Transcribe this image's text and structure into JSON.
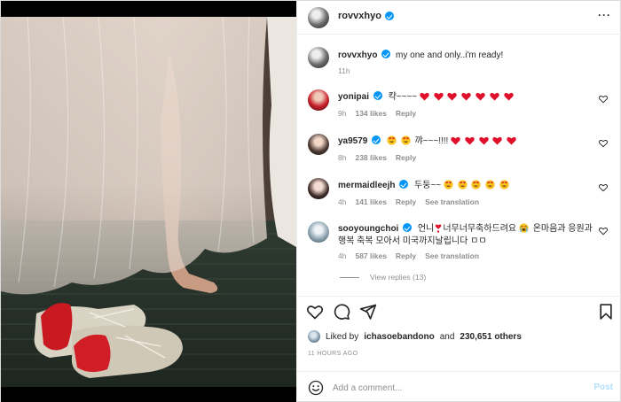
{
  "post": {
    "username": "rovvxhyo",
    "more_label": "···",
    "caption": "my one and only..i'm ready!",
    "caption_time": "11h"
  },
  "comments": [
    {
      "username": "yonipai",
      "text": "캭~~~~",
      "emoji_after": [
        "heart",
        "heart",
        "heart",
        "heart",
        "heart",
        "heart",
        "heart"
      ],
      "time": "9h",
      "likes": "134 likes",
      "reply": "Reply",
      "translation": ""
    },
    {
      "username": "ya9579",
      "text": "꺄~~~!!!!",
      "emoji_before": [
        "heart-eyes-face",
        "heart-eyes-face"
      ],
      "emoji_after": [
        "heart",
        "heart",
        "heart",
        "heart",
        "heart"
      ],
      "time": "8h",
      "likes": "238 likes",
      "reply": "Reply",
      "translation": ""
    },
    {
      "username": "mermaidleejh",
      "text": "두둥~~",
      "emoji_after": [
        "heart-eyes-face",
        "heart-eyes-face",
        "heart-eyes-face",
        "heart-eyes-face",
        "heart-eyes-face"
      ],
      "time": "4h",
      "likes": "141 likes",
      "reply": "Reply",
      "translation": "See translation"
    },
    {
      "username": "sooyoungchoi",
      "text_part1": "언니",
      "text_part2": "너무너무축하드려요",
      "text_part3": "온마음과 응원과 행복 축복 모아서 미국까지날립니다 ㅁㅁ",
      "time": "4h",
      "likes": "587 likes",
      "reply": "Reply",
      "translation": "See translation"
    }
  ],
  "view_replies": "View replies (13)",
  "liked_by": {
    "prefix": "Liked by",
    "user": "ichasoebandono",
    "joiner": "and",
    "count": "230,651 others"
  },
  "post_time": "11 HOURS AGO",
  "add_comment": {
    "placeholder": "Add a comment...",
    "post_label": "Post"
  },
  "colors": {
    "verified": "#0095f6",
    "muted_text": "#8e8e8e",
    "post_button": "#b2dffc",
    "heart_emoji": "#e0102a"
  }
}
